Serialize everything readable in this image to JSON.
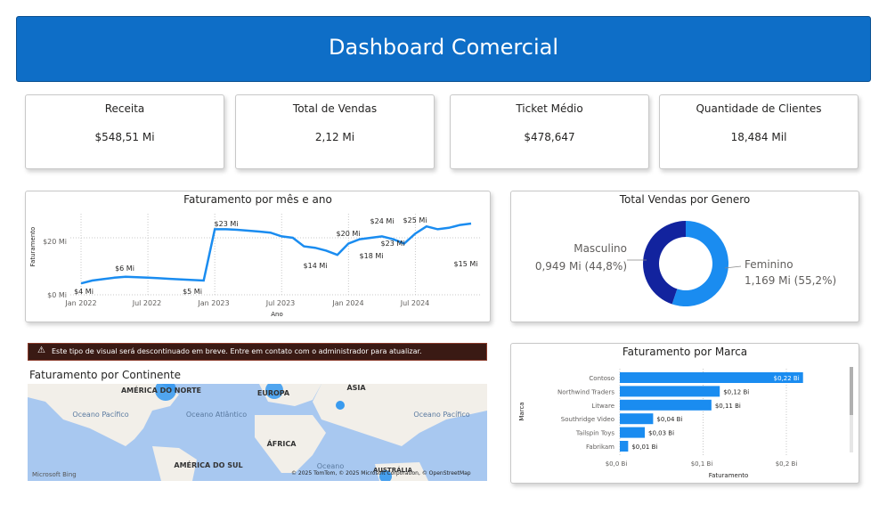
{
  "header": {
    "title": "Dashboard Comercial"
  },
  "kpis": [
    {
      "title": "Receita",
      "value": "$548,51 Mi"
    },
    {
      "title": "Total de Vendas",
      "value": "2,12 Mi"
    },
    {
      "title": "Ticket Médio",
      "value": "$478,647"
    },
    {
      "title": "Quantidade de Clientes",
      "value": "18,484 Mil"
    }
  ],
  "line_chart": {
    "title": "Faturamento por mês e ano",
    "xlabel": "Ano",
    "ylabel": "Faturamento",
    "y_ticks": [
      "$20 Mi",
      "$0 Mi"
    ],
    "x_ticks": [
      "Jan 2022",
      "Jul 2022",
      "Jan 2023",
      "Jul 2023",
      "Jan 2024",
      "Jul 2024"
    ],
    "data_labels": [
      "$4 Mi",
      "$6 Mi",
      "$5 Mi",
      "$23 Mi",
      "$14 Mi",
      "$20 Mi",
      "$18 Mi",
      "$24 Mi",
      "$23 Mi",
      "$25 Mi",
      "$15 Mi"
    ],
    "color": "#1a8cf0"
  },
  "donut": {
    "title": "Total Vendas por Genero",
    "segments": [
      {
        "label": "Masculino",
        "value_text": "0,949 Mi (44,8%)",
        "color": "#12239e"
      },
      {
        "label": "Feminino",
        "value_text": "1,169 Mi (55,2%)",
        "color": "#1a8cf0"
      }
    ]
  },
  "warning": {
    "icon": "warning-icon",
    "text": "Este tipo de visual será descontinuado em breve. Entre em contato com o administrador para atualizar."
  },
  "map": {
    "title": "Faturamento por Continente",
    "labels": [
      "AMÉRICA DO NORTE",
      "EUROPA",
      "ÁSIA",
      "Oceano Pacífico",
      "Oceano Atlântico",
      "ÁFRICA",
      "Oceano Índico",
      "Oceano Pacífico",
      "AMÉRICA DO SUL",
      "Oceano",
      "AUSTRÁLIA"
    ],
    "attribution": "© 2025 TomTom, © 2025 Microsoft Corporation, © OpenStreetMap"
  },
  "bar_chart": {
    "title": "Faturamento por Marca",
    "ylabel": "Marca",
    "xlabel": "Faturamento",
    "x_ticks": [
      "$0,0 Bi",
      "$0,1 Bi",
      "$0,2 Bi"
    ],
    "color": "#1a8cf0"
  },
  "chart_data": [
    {
      "type": "line",
      "title": "Faturamento por mês e ano",
      "xlabel": "Ano",
      "ylabel": "Faturamento",
      "x": [
        "2022-01",
        "2022-02",
        "2022-03",
        "2022-04",
        "2022-05",
        "2022-06",
        "2022-07",
        "2022-08",
        "2022-09",
        "2022-10",
        "2022-11",
        "2022-12",
        "2023-01",
        "2023-02",
        "2023-03",
        "2023-04",
        "2023-05",
        "2023-06",
        "2023-07",
        "2023-08",
        "2023-09",
        "2023-10",
        "2023-11",
        "2023-12",
        "2024-01",
        "2024-02",
        "2024-03",
        "2024-04",
        "2024-05",
        "2024-06",
        "2024-07",
        "2024-08",
        "2024-09",
        "2024-10",
        "2024-11",
        "2024-12"
      ],
      "values": [
        4,
        5,
        5.5,
        6,
        6.3,
        6.2,
        6,
        5.8,
        5.6,
        5.4,
        5.2,
        5,
        23,
        23,
        22.8,
        22.5,
        22.2,
        21.8,
        20.5,
        20,
        17,
        16.5,
        15.5,
        14,
        18,
        19.5,
        20,
        20.5,
        19.5,
        18,
        21.5,
        24,
        23,
        23.5,
        24.5,
        25
      ],
      "ylim": [
        0,
        30
      ]
    },
    {
      "type": "pie",
      "title": "Total Vendas por Genero",
      "categories": [
        "Masculino",
        "Feminino"
      ],
      "values": [
        0.949,
        1.169
      ],
      "unit": "Mi"
    },
    {
      "type": "bar",
      "title": "Faturamento por Marca",
      "xlabel": "Faturamento",
      "ylabel": "Marca",
      "categories": [
        "Contoso",
        "Northwind Traders",
        "Litware",
        "Southridge Video",
        "Tailspin Toys",
        "Fabrikam"
      ],
      "values": [
        0.22,
        0.12,
        0.11,
        0.04,
        0.03,
        0.01
      ],
      "data_labels": [
        "$0,22 Bi",
        "$0,12 Bi",
        "$0,11 Bi",
        "$0,04 Bi",
        "$0,03 Bi",
        "$0,01 Bi"
      ],
      "xlim": [
        0,
        0.23
      ]
    }
  ]
}
